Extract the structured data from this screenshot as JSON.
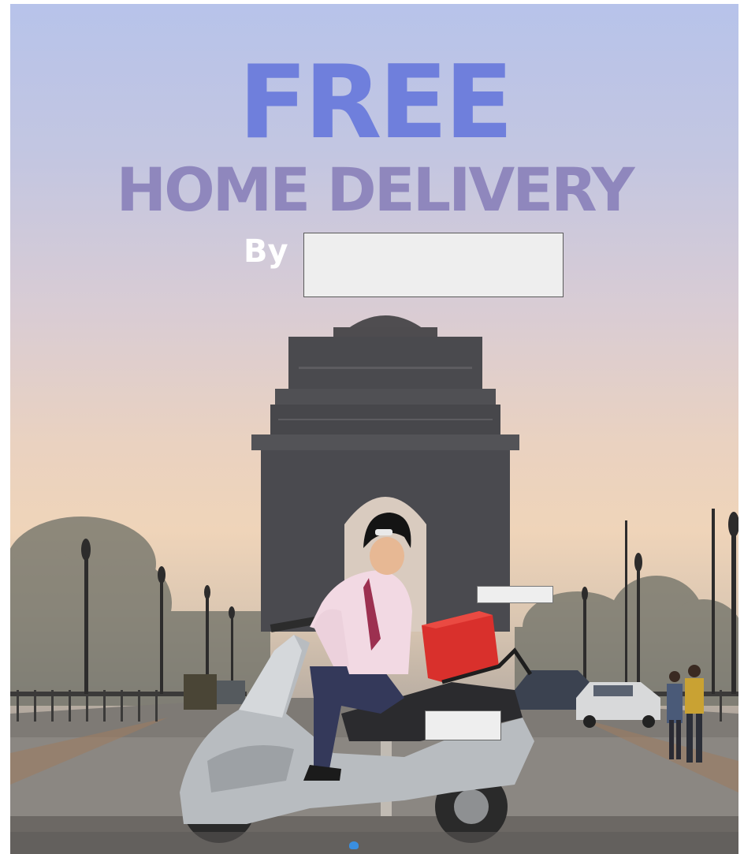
{
  "poster": {
    "headline": "FREE",
    "subheadline": "HOME DELIVERY",
    "by_label": "By"
  },
  "colors": {
    "headline": "#6f7fdc",
    "subheadline": "#8f87bd",
    "by_label": "#ffffff",
    "delivery_box": "#d9302c"
  }
}
